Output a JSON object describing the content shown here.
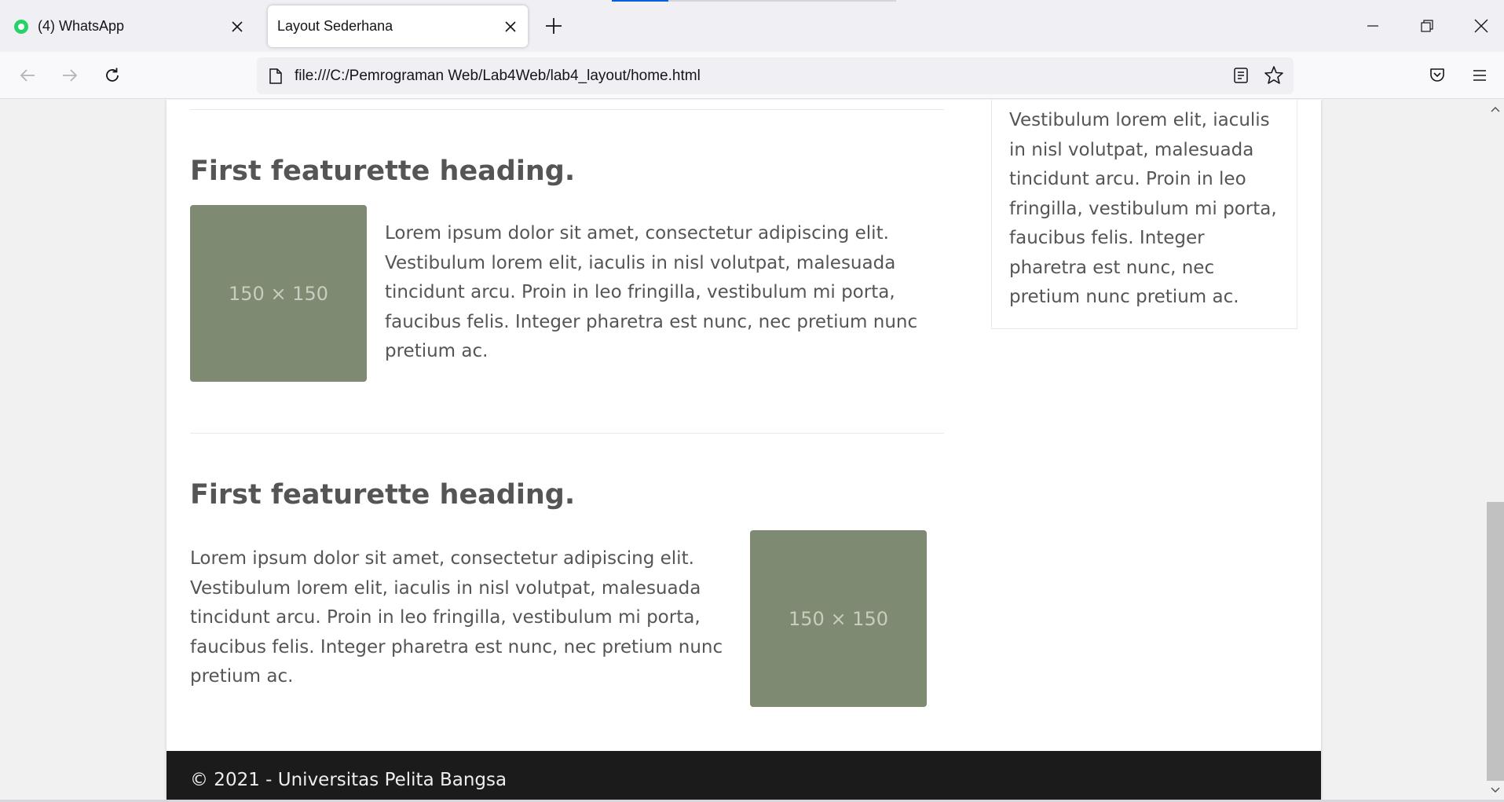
{
  "browser": {
    "tabs": [
      {
        "title": "(4) WhatsApp",
        "active": false,
        "favicon": "whatsapp-icon"
      },
      {
        "title": "Layout Sederhana",
        "active": true,
        "favicon": ""
      }
    ],
    "url": "file:///C:/Pemrograman Web/Lab4Web/lab4_layout/home.html",
    "accent_color": "#0060df"
  },
  "page": {
    "sidebar_text": "Vestibulum lorem elit, iaculis in nisl volutpat, malesuada tincidunt arcu. Proin in leo fringilla, vestibulum mi porta, faucibus felis. Integer pharetra est nunc, nec pretium nunc pretium ac.",
    "featurettes": [
      {
        "heading": "First featurette heading.",
        "image_label": "150 × 150",
        "image_side": "left",
        "text": "Lorem ipsum dolor sit amet, consectetur adipiscing elit. Vestibulum lorem elit, iaculis in nisl volutpat, malesuada tincidunt arcu. Proin in leo fringilla, vestibulum mi porta, faucibus felis. Integer pharetra est nunc, nec pretium nunc pretium ac."
      },
      {
        "heading": "First featurette heading.",
        "image_label": "150 × 150",
        "image_side": "right",
        "text": "Lorem ipsum dolor sit amet, consectetur adipiscing elit. Vestibulum lorem elit, iaculis in nisl volutpat, malesuada tincidunt arcu. Proin in leo fringilla, vestibulum mi porta, faucibus felis. Integer pharetra est nunc, nec pretium nunc pretium ac."
      }
    ],
    "footer_text": "© 2021 - Universitas Pelita Bangsa",
    "colors": {
      "placeholder_bg": "#7f8a73",
      "footer_bg": "#1b1b1b",
      "text": "#555555"
    }
  }
}
